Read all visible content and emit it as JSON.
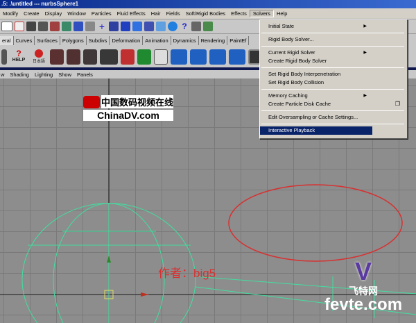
{
  "window": {
    "title": ".5: .\\untitled  ---  nurbsSphere1"
  },
  "menubar": {
    "items": [
      "Modify",
      "Create",
      "Display",
      "Window",
      "Particles",
      "Fluid Effects",
      "Hair",
      "Fields",
      "Soft/Rigid Bodies",
      "Effects",
      "Solvers",
      "Help"
    ],
    "active": "Solvers"
  },
  "shelf_tabs": [
    "eral",
    "Curves",
    "Surfaces",
    "Polygons",
    "Subdivs",
    "Deformation",
    "Animation",
    "Dynamics",
    "Rendering",
    "PaintEf"
  ],
  "shelf_labels": {
    "help": "HELP",
    "jp": "日本語"
  },
  "panel_menu": [
    "w",
    "Shading",
    "Lighting",
    "Show",
    "Panels"
  ],
  "solvers_menu": {
    "groups": [
      [
        {
          "label": "Initial State",
          "submenu": true
        }
      ],
      [
        {
          "label": "Rigid Body Solver..."
        }
      ],
      [
        {
          "label": "Current Rigid Solver",
          "submenu": true
        },
        {
          "label": "Create Rigid Body Solver"
        }
      ],
      [
        {
          "label": "Set Rigid Body Interpenetration"
        },
        {
          "label": "Set Rigid Body Collision"
        }
      ],
      [
        {
          "label": "Memory Caching",
          "submenu": true
        },
        {
          "label": "Create Particle Disk Cache",
          "option": true
        }
      ],
      [
        {
          "label": "Edit Oversampling or Cache Settings..."
        }
      ],
      [
        {
          "label": "Interactive Playback",
          "selected": true
        }
      ]
    ]
  },
  "watermarks": {
    "chinadv_cn": "中国数码视频在线",
    "chinadv_en": "ChinaDV.com",
    "author": "作者：big5",
    "fevte_cn": "飞特网",
    "fevte_en": "fevte.com"
  },
  "colors": {
    "highlight": "#0a246a",
    "annotation": "#d83030",
    "wireframe": "#40e0a0"
  }
}
